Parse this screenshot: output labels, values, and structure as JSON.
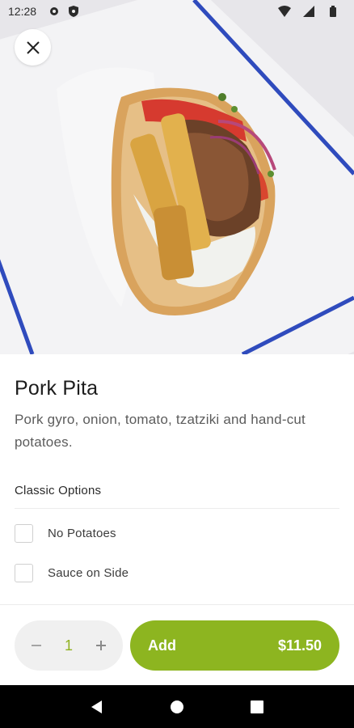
{
  "status_bar": {
    "time": "12:28",
    "icons": [
      "gear-icon",
      "shield-icon",
      "wifi-icon",
      "signal-icon",
      "battery-icon"
    ]
  },
  "hero": {
    "image": "pork-pita-photo",
    "close_icon": "close-icon"
  },
  "product": {
    "title": "Pork Pita",
    "description": "Pork gyro, onion, tomato, tzatziki and hand-cut potatoes."
  },
  "options_group": {
    "title": "Classic Options",
    "options": [
      {
        "label": "No Potatoes",
        "checked": false
      },
      {
        "label": "Sauce on Side",
        "checked": false
      }
    ]
  },
  "cart": {
    "decrement_icon": "minus-icon",
    "quantity": "1",
    "increment_icon": "plus-icon",
    "add_label": "Add",
    "price": "$11.50"
  },
  "colors": {
    "accent": "#8db520",
    "quantity_text": "#8fb21f",
    "tray_border": "#2f4bbd"
  },
  "nav_bar": {
    "icons": [
      "back-icon",
      "home-icon",
      "recents-icon"
    ]
  }
}
